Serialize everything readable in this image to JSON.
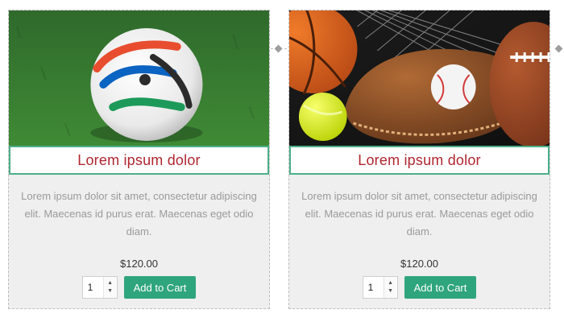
{
  "products": [
    {
      "title": "Lorem ipsum dolor",
      "description": "Lorem ipsum dolor sit amet, consectetur adipiscing elit. Maecenas id purus erat. Maecenas eget odio diam.",
      "price": "$120.00",
      "quantity": "1",
      "add_to_cart_label": "Add to Cart",
      "image_icon": "soccer-ball-image"
    },
    {
      "title": "Lorem ipsum dolor",
      "description": "Lorem ipsum dolor sit amet, consectetur adipiscing elit. Maecenas id purus erat. Maecenas eget odio diam.",
      "price": "$120.00",
      "quantity": "1",
      "add_to_cart_label": "Add to Cart",
      "image_icon": "sports-equipment-image"
    }
  ],
  "colors": {
    "title_red": "#b0262f",
    "accent_green": "#2fa57d",
    "border_green": "#4caf8a",
    "card_background": "#efefef",
    "description_gray": "#9a9a9a"
  },
  "icons": {
    "stepper_up": "▲",
    "stepper_down": "▼"
  }
}
